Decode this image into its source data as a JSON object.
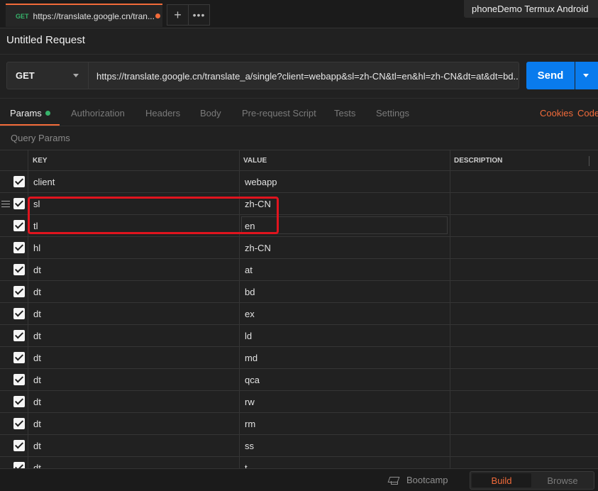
{
  "tab": {
    "method": "GET",
    "url": "https://translate.google.cn/tran..."
  },
  "environment": "phoneDemo Termux Android",
  "request_title": "Untitled Request",
  "request": {
    "method": "GET",
    "url": "https://translate.google.cn/translate_a/single?client=webapp&sl=zh-CN&tl=en&hl=zh-CN&dt=at&dt=bd...",
    "send_label": "Send"
  },
  "subtabs": {
    "params": "Params",
    "authorization": "Authorization",
    "headers": "Headers",
    "body": "Body",
    "prerequest": "Pre-request Script",
    "tests": "Tests",
    "settings": "Settings",
    "cookies": "Cookies",
    "code": "Code"
  },
  "query_params_label": "Query Params",
  "columns": {
    "key": "KEY",
    "value": "VALUE",
    "description": "DESCRIPTION"
  },
  "params": [
    {
      "key": "client",
      "value": "webapp"
    },
    {
      "key": "sl",
      "value": "zh-CN"
    },
    {
      "key": "tl",
      "value": "en"
    },
    {
      "key": "hl",
      "value": "zh-CN"
    },
    {
      "key": "dt",
      "value": "at"
    },
    {
      "key": "dt",
      "value": "bd"
    },
    {
      "key": "dt",
      "value": "ex"
    },
    {
      "key": "dt",
      "value": "ld"
    },
    {
      "key": "dt",
      "value": "md"
    },
    {
      "key": "dt",
      "value": "qca"
    },
    {
      "key": "dt",
      "value": "rw"
    },
    {
      "key": "dt",
      "value": "rm"
    },
    {
      "key": "dt",
      "value": "ss"
    },
    {
      "key": "dt",
      "value": "t"
    }
  ],
  "footer": {
    "bootcamp": "Bootcamp",
    "build": "Build",
    "browse": "Browse"
  },
  "colors": {
    "accent": "#f26b3a",
    "send": "#097bed",
    "highlight": "#e0141e",
    "get_method": "#37b36b"
  }
}
